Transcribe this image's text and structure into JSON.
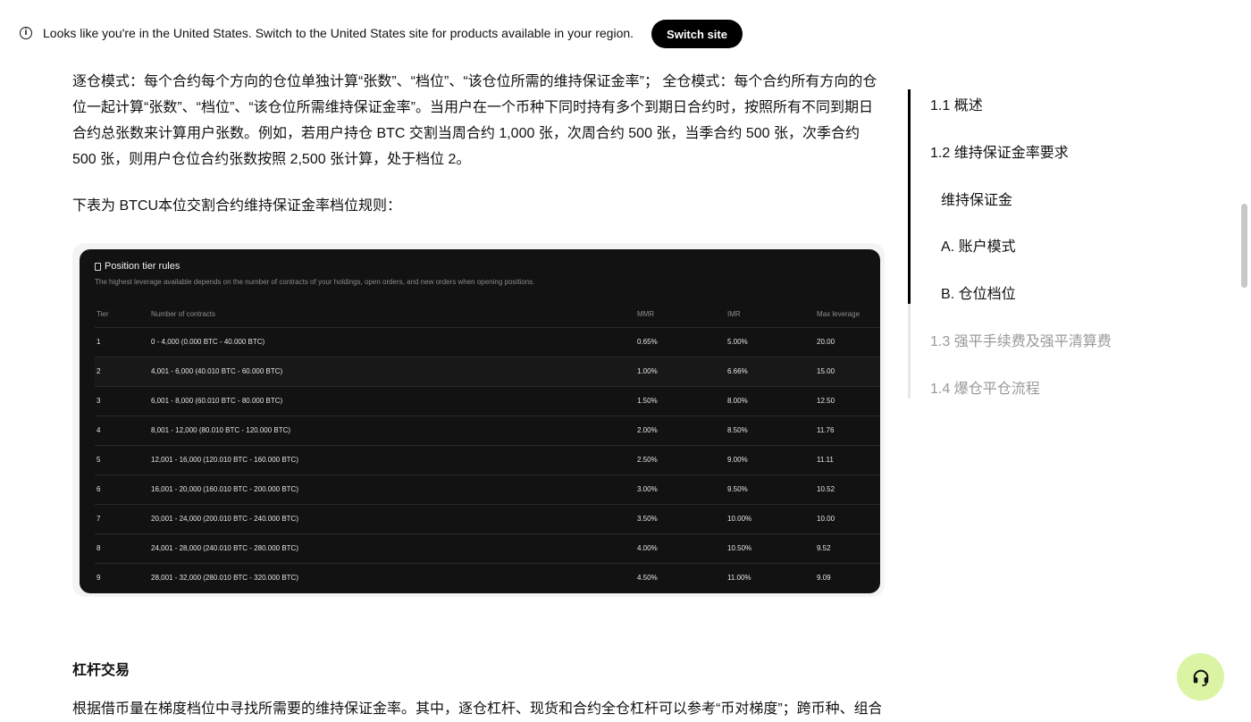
{
  "banner": {
    "message": "Looks like you're in the United States. Switch to the United States site for products available in your region.",
    "button_label": "Switch site",
    "icon": "info-icon"
  },
  "article": {
    "para1": "逐仓模式：每个合约每个方向的仓位单独计算“张数”、“档位”、“该仓位所需的维持保证金率”； 全仓模式：每个合约所有方向的仓位一起计算“张数”、“档位”、“该仓位所需维持保证金率”。当用户在一个币种下同时持有多个到期日合约时，按照所有不同到期日合约总张数来计算用户张数。例如，若用户持仓 BTC 交割当周合约 1,000 张，次周合约 500 张，当季合约 500 张，次季合约 500 张，则用户仓位合约张数按照 2,500 张计算，处于档位 2。",
    "para2": "下表为 BTCU本位交割合约维持保证金率档位规则：",
    "section_heading": "杠杆交易",
    "para3": "根据借币量在梯度档位中寻找所需要的维持保证金率。其中，逐仓杠杆、现货和合约全仓杠杆可以参考“币对梯度”；跨币种、组合"
  },
  "table": {
    "title": "Position tier rules",
    "subtitle": "The highest leverage available depends on the number of contracts of your holdings, open orders, and new orders when opening positions.",
    "headers": [
      "Tier",
      "Number of contracts",
      "MMR",
      "IMR",
      "Max leverage"
    ],
    "rows": [
      [
        "1",
        "0 - 4,000 (0.000 BTC - 40.000 BTC)",
        "0.65%",
        "5.00%",
        "20.00"
      ],
      [
        "2",
        "4,001 - 6,000 (40.010 BTC - 60.000 BTC)",
        "1.00%",
        "6.66%",
        "15.00"
      ],
      [
        "3",
        "6,001 - 8,000 (60.010 BTC - 80.000 BTC)",
        "1.50%",
        "8.00%",
        "12.50"
      ],
      [
        "4",
        "8,001 - 12,000 (80.010 BTC - 120.000 BTC)",
        "2.00%",
        "8.50%",
        "11.76"
      ],
      [
        "5",
        "12,001 - 16,000 (120.010 BTC - 160.000 BTC)",
        "2.50%",
        "9.00%",
        "11.11"
      ],
      [
        "6",
        "16,001 - 20,000 (160.010 BTC - 200.000 BTC)",
        "3.00%",
        "9.50%",
        "10.52"
      ],
      [
        "7",
        "20,001 - 24,000 (200.010 BTC - 240.000 BTC)",
        "3.50%",
        "10.00%",
        "10.00"
      ],
      [
        "8",
        "24,001 - 28,000 (240.010 BTC - 280.000 BTC)",
        "4.00%",
        "10.50%",
        "9.52"
      ],
      [
        "9",
        "28,001 - 32,000 (280.010 BTC - 320.000 BTC)",
        "4.50%",
        "11.00%",
        "9.09"
      ]
    ]
  },
  "toc": {
    "items": [
      {
        "label": "1.1 概述",
        "active": true
      },
      {
        "label": "1.2 维持保证金率要求",
        "active": true
      },
      {
        "label": "维持保证金",
        "active": true
      },
      {
        "label": "A. 账户模式",
        "active": true
      },
      {
        "label": "B. 仓位档位",
        "active": true
      },
      {
        "label": "1.3 强平手续费及强平清算费",
        "active": false
      },
      {
        "label": "1.4 爆仓平仓流程",
        "active": false
      }
    ]
  },
  "support": {
    "icon": "headset-icon"
  },
  "colors": {
    "accent_support": "#dbf4a4",
    "button_bg": "#000000",
    "table_bg": "#121212"
  }
}
